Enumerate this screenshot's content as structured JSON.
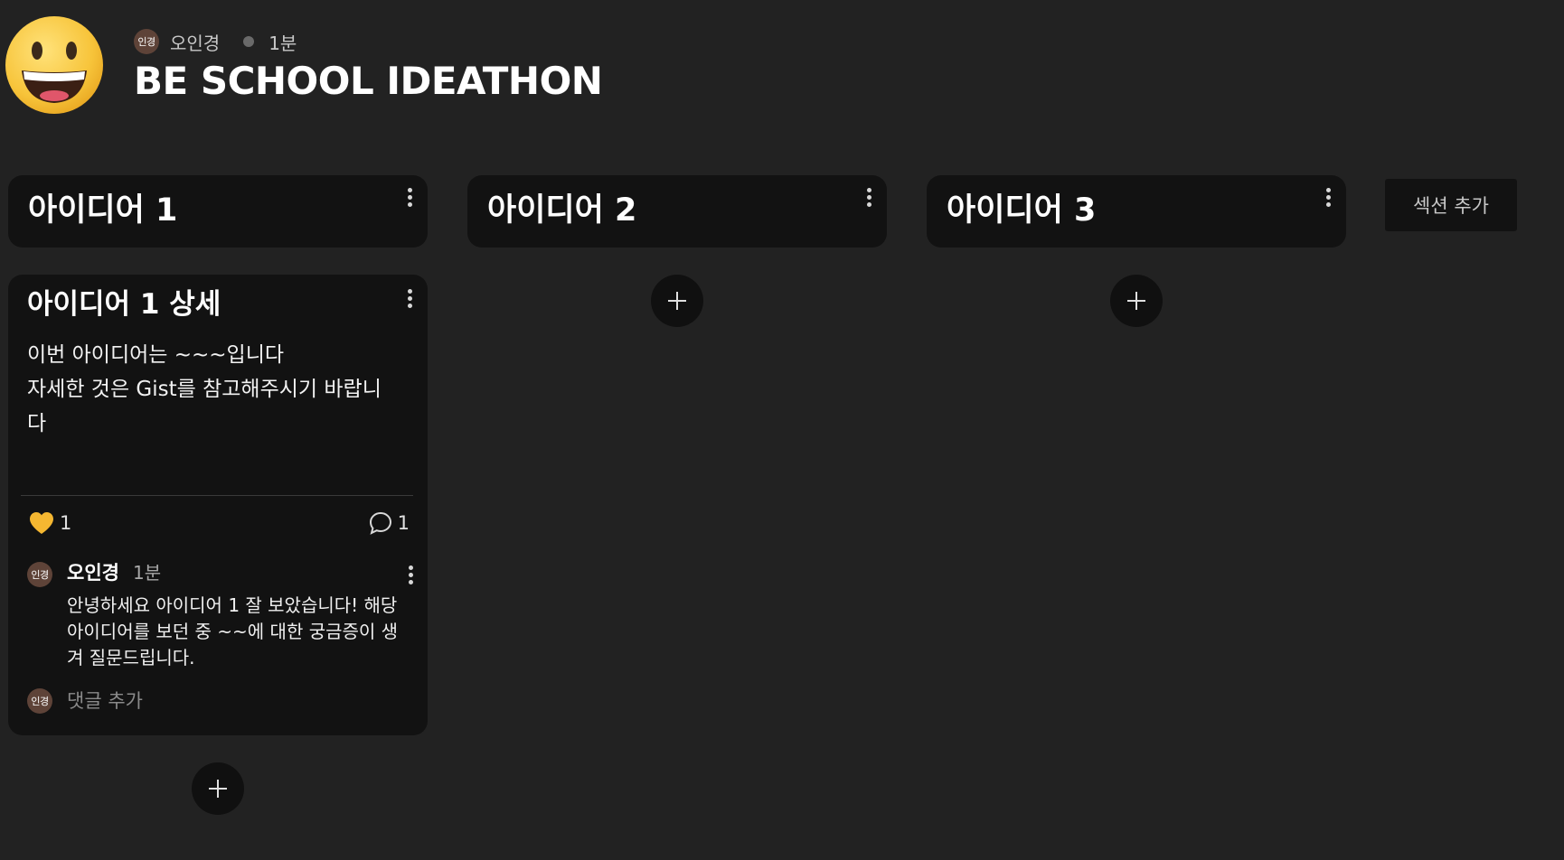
{
  "board": {
    "author_avatar": "인경",
    "author_name": "오인경",
    "time": "1분",
    "title": "BE SCHOOL IDEATHON",
    "emoji": "grinning-face-icon"
  },
  "sections": [
    {
      "title": "아이디어 1"
    },
    {
      "title": "아이디어 2"
    },
    {
      "title": "아이디어 3"
    }
  ],
  "add_section_label": "섹션 추가",
  "card": {
    "title": "아이디어 1 상세",
    "body_lines": [
      "이번 아이디어는 ~~~입니다",
      "자세한 것은 Gist를 참고해주시기 바랍니",
      "다"
    ],
    "likes": "1",
    "comments": "1",
    "comment": {
      "avatar": "인경",
      "author": "오인경",
      "time": "1분",
      "text_lines": [
        "안녕하세요 아이디어 1 잘 보았습니다! 해당",
        "아이디어를 보던 중 ~~에 대한 궁금증이 생",
        "겨 질문드립니다."
      ]
    },
    "add_comment_avatar": "인경",
    "add_comment_placeholder": "댓글 추가"
  },
  "colors": {
    "background": "#222222",
    "panel": "#121212",
    "heart": "#f5b731",
    "avatar": "#5e4338"
  }
}
